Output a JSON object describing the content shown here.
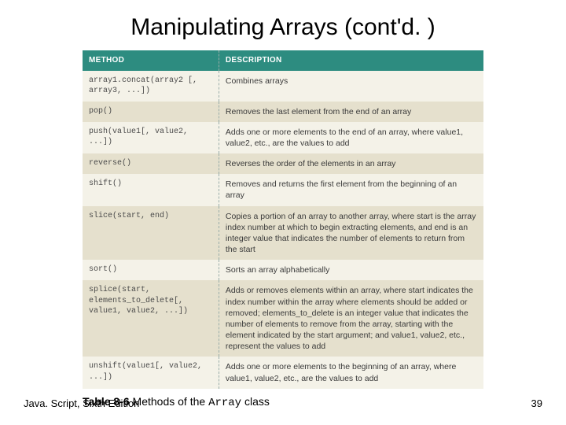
{
  "title": "Manipulating Arrays (cont'd. )",
  "table": {
    "headers": {
      "method": "METHOD",
      "description": "DESCRIPTION"
    },
    "rows": [
      {
        "method": "array1.concat(array2 [, array3, ...])",
        "desc": "Combines arrays"
      },
      {
        "method": "pop()",
        "desc": "Removes the last element from the end of an array"
      },
      {
        "method": "push(value1[, value2, ...])",
        "desc": "Adds one or more elements to the end of an array, where value1, value2, etc., are the values to add"
      },
      {
        "method": "reverse()",
        "desc": "Reverses the order of the elements in an array"
      },
      {
        "method": "shift()",
        "desc": "Removes and returns the first element from the beginning of an array"
      },
      {
        "method": "slice(start, end)",
        "desc": "Copies a portion of an array to another array, where start is the array index number at which to begin extracting elements, and end is an integer value that indicates the number of elements to return from the start"
      },
      {
        "method": "sort()",
        "desc": "Sorts an array alphabetically"
      },
      {
        "method": "splice(start, elements_to_delete[, value1, value2, ...])",
        "desc": "Adds or removes elements within an array, where start indicates the index number within the array where elements should be added or removed; elements_to_delete is an integer value that indicates the number of elements to remove from the array, starting with the element indicated by the start argument; and value1, value2, etc., represent the values to add"
      },
      {
        "method": "unshift(value1[, value2, ...])",
        "desc": "Adds one or more elements to the beginning of an array, where value1, value2, etc., are the values to add"
      }
    ]
  },
  "caption": {
    "prefix": "Table 8-6",
    "mid": " Methods of the ",
    "code": "Array",
    "suffix": " class"
  },
  "footer": {
    "left": "Java. Script, Sixth Edition",
    "right": "39"
  }
}
